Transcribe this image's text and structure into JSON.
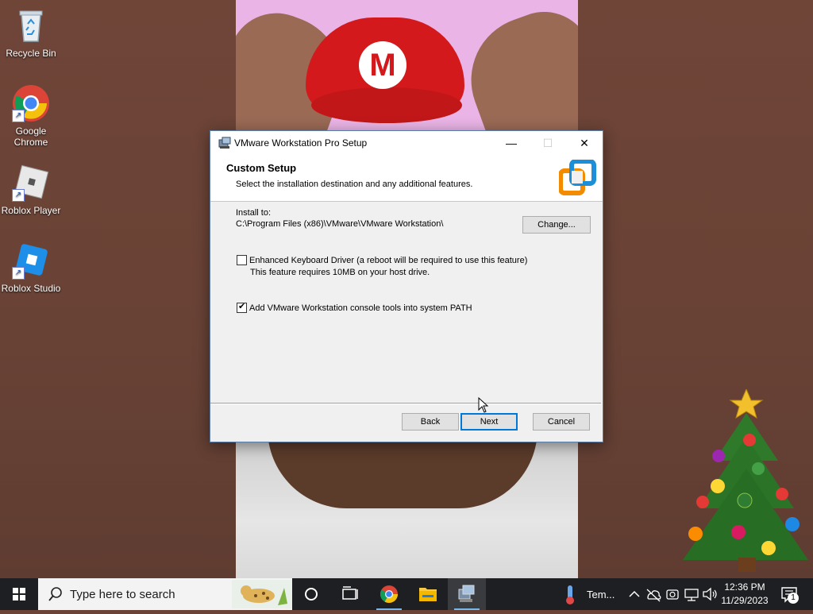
{
  "desktop": {
    "icons": [
      {
        "label": "Recycle Bin"
      },
      {
        "label": "Google Chrome"
      },
      {
        "label": "Roblox Player"
      },
      {
        "label": "Roblox Studio"
      }
    ]
  },
  "dialog": {
    "title": "VMware Workstation Pro Setup",
    "header_title": "Custom Setup",
    "header_subtitle": "Select the installation destination and any additional features.",
    "install_to_label": "Install to:",
    "install_path": "C:\\Program Files (x86)\\VMware\\VMware Workstation\\",
    "change_button": "Change...",
    "option1_label": "Enhanced Keyboard Driver (a reboot will be required to use this feature)",
    "option1_note": "This feature requires 10MB on your host drive.",
    "option1_checked": false,
    "option2_label": "Add VMware Workstation console tools into system PATH",
    "option2_checked": true,
    "back_button": "Back",
    "next_button": "Next",
    "cancel_button": "Cancel",
    "minimize_glyph": "—",
    "maximize_glyph": "☐",
    "close_glyph": "✕"
  },
  "taskbar": {
    "search_placeholder": "Type here to search",
    "weather_text": "Tem...",
    "time": "12:36 PM",
    "date": "11/29/2023",
    "notification_count": "1"
  },
  "colors": {
    "accent": "#0078d7",
    "vmware_orange": "#f38b00",
    "vmware_blue": "#1d8fd8"
  }
}
